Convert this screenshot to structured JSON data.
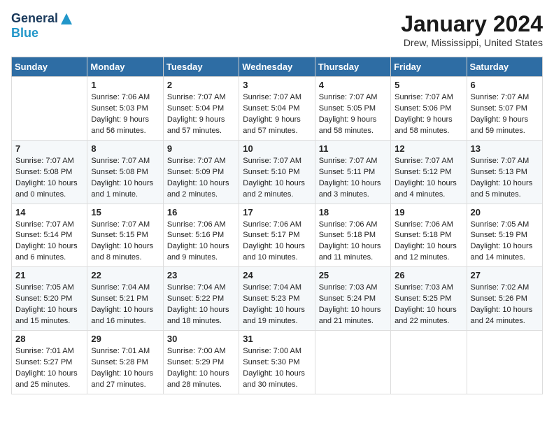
{
  "logo": {
    "general": "General",
    "blue": "Blue"
  },
  "title": "January 2024",
  "location": "Drew, Mississippi, United States",
  "days_header": [
    "Sunday",
    "Monday",
    "Tuesday",
    "Wednesday",
    "Thursday",
    "Friday",
    "Saturday"
  ],
  "weeks": [
    [
      {
        "day": "",
        "info": ""
      },
      {
        "day": "1",
        "info": "Sunrise: 7:06 AM\nSunset: 5:03 PM\nDaylight: 9 hours\nand 56 minutes."
      },
      {
        "day": "2",
        "info": "Sunrise: 7:07 AM\nSunset: 5:04 PM\nDaylight: 9 hours\nand 57 minutes."
      },
      {
        "day": "3",
        "info": "Sunrise: 7:07 AM\nSunset: 5:04 PM\nDaylight: 9 hours\nand 57 minutes."
      },
      {
        "day": "4",
        "info": "Sunrise: 7:07 AM\nSunset: 5:05 PM\nDaylight: 9 hours\nand 58 minutes."
      },
      {
        "day": "5",
        "info": "Sunrise: 7:07 AM\nSunset: 5:06 PM\nDaylight: 9 hours\nand 58 minutes."
      },
      {
        "day": "6",
        "info": "Sunrise: 7:07 AM\nSunset: 5:07 PM\nDaylight: 9 hours\nand 59 minutes."
      }
    ],
    [
      {
        "day": "7",
        "info": "Sunrise: 7:07 AM\nSunset: 5:08 PM\nDaylight: 10 hours\nand 0 minutes."
      },
      {
        "day": "8",
        "info": "Sunrise: 7:07 AM\nSunset: 5:08 PM\nDaylight: 10 hours\nand 1 minute."
      },
      {
        "day": "9",
        "info": "Sunrise: 7:07 AM\nSunset: 5:09 PM\nDaylight: 10 hours\nand 2 minutes."
      },
      {
        "day": "10",
        "info": "Sunrise: 7:07 AM\nSunset: 5:10 PM\nDaylight: 10 hours\nand 2 minutes."
      },
      {
        "day": "11",
        "info": "Sunrise: 7:07 AM\nSunset: 5:11 PM\nDaylight: 10 hours\nand 3 minutes."
      },
      {
        "day": "12",
        "info": "Sunrise: 7:07 AM\nSunset: 5:12 PM\nDaylight: 10 hours\nand 4 minutes."
      },
      {
        "day": "13",
        "info": "Sunrise: 7:07 AM\nSunset: 5:13 PM\nDaylight: 10 hours\nand 5 minutes."
      }
    ],
    [
      {
        "day": "14",
        "info": "Sunrise: 7:07 AM\nSunset: 5:14 PM\nDaylight: 10 hours\nand 6 minutes."
      },
      {
        "day": "15",
        "info": "Sunrise: 7:07 AM\nSunset: 5:15 PM\nDaylight: 10 hours\nand 8 minutes."
      },
      {
        "day": "16",
        "info": "Sunrise: 7:06 AM\nSunset: 5:16 PM\nDaylight: 10 hours\nand 9 minutes."
      },
      {
        "day": "17",
        "info": "Sunrise: 7:06 AM\nSunset: 5:17 PM\nDaylight: 10 hours\nand 10 minutes."
      },
      {
        "day": "18",
        "info": "Sunrise: 7:06 AM\nSunset: 5:18 PM\nDaylight: 10 hours\nand 11 minutes."
      },
      {
        "day": "19",
        "info": "Sunrise: 7:06 AM\nSunset: 5:18 PM\nDaylight: 10 hours\nand 12 minutes."
      },
      {
        "day": "20",
        "info": "Sunrise: 7:05 AM\nSunset: 5:19 PM\nDaylight: 10 hours\nand 14 minutes."
      }
    ],
    [
      {
        "day": "21",
        "info": "Sunrise: 7:05 AM\nSunset: 5:20 PM\nDaylight: 10 hours\nand 15 minutes."
      },
      {
        "day": "22",
        "info": "Sunrise: 7:04 AM\nSunset: 5:21 PM\nDaylight: 10 hours\nand 16 minutes."
      },
      {
        "day": "23",
        "info": "Sunrise: 7:04 AM\nSunset: 5:22 PM\nDaylight: 10 hours\nand 18 minutes."
      },
      {
        "day": "24",
        "info": "Sunrise: 7:04 AM\nSunset: 5:23 PM\nDaylight: 10 hours\nand 19 minutes."
      },
      {
        "day": "25",
        "info": "Sunrise: 7:03 AM\nSunset: 5:24 PM\nDaylight: 10 hours\nand 21 minutes."
      },
      {
        "day": "26",
        "info": "Sunrise: 7:03 AM\nSunset: 5:25 PM\nDaylight: 10 hours\nand 22 minutes."
      },
      {
        "day": "27",
        "info": "Sunrise: 7:02 AM\nSunset: 5:26 PM\nDaylight: 10 hours\nand 24 minutes."
      }
    ],
    [
      {
        "day": "28",
        "info": "Sunrise: 7:01 AM\nSunset: 5:27 PM\nDaylight: 10 hours\nand 25 minutes."
      },
      {
        "day": "29",
        "info": "Sunrise: 7:01 AM\nSunset: 5:28 PM\nDaylight: 10 hours\nand 27 minutes."
      },
      {
        "day": "30",
        "info": "Sunrise: 7:00 AM\nSunset: 5:29 PM\nDaylight: 10 hours\nand 28 minutes."
      },
      {
        "day": "31",
        "info": "Sunrise: 7:00 AM\nSunset: 5:30 PM\nDaylight: 10 hours\nand 30 minutes."
      },
      {
        "day": "",
        "info": ""
      },
      {
        "day": "",
        "info": ""
      },
      {
        "day": "",
        "info": ""
      }
    ]
  ]
}
